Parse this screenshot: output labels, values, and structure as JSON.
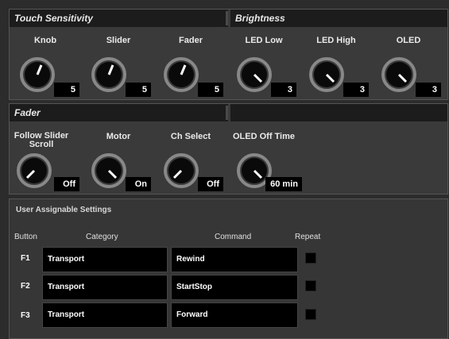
{
  "touch_sensitivity": {
    "title": "Touch Sensitivity",
    "knobs": [
      {
        "label": "Knob",
        "value": "5"
      },
      {
        "label": "Slider",
        "value": "5"
      },
      {
        "label": "Fader",
        "value": "5"
      }
    ]
  },
  "brightness": {
    "title": "Brightness",
    "knobs": [
      {
        "label": "LED Low",
        "value": "3"
      },
      {
        "label": "LED High",
        "value": "3"
      },
      {
        "label": "OLED",
        "value": "3"
      }
    ]
  },
  "fader": {
    "title": "Fader",
    "knobs": [
      {
        "label": "Follow Slider Scroll",
        "value": "Off"
      },
      {
        "label": "Motor",
        "value": "On"
      },
      {
        "label": "Ch Select",
        "value": "Off"
      },
      {
        "label": "OLED Off Time",
        "value": "60 min"
      }
    ]
  },
  "user_settings": {
    "title": "User Assignable Settings",
    "col_button": "Button",
    "col_category": "Category",
    "col_command": "Command",
    "col_repeat": "Repeat",
    "rows": [
      {
        "button": "F1",
        "category": "Transport",
        "command": "Rewind"
      },
      {
        "button": "F2",
        "category": "Transport",
        "command": "StartStop"
      },
      {
        "button": "F3",
        "category": "Transport",
        "command": "Forward"
      }
    ]
  },
  "colors": {
    "panel_bg": "#3a3a3a",
    "header_bg": "#1c1c1c",
    "field_bg": "#000000"
  }
}
